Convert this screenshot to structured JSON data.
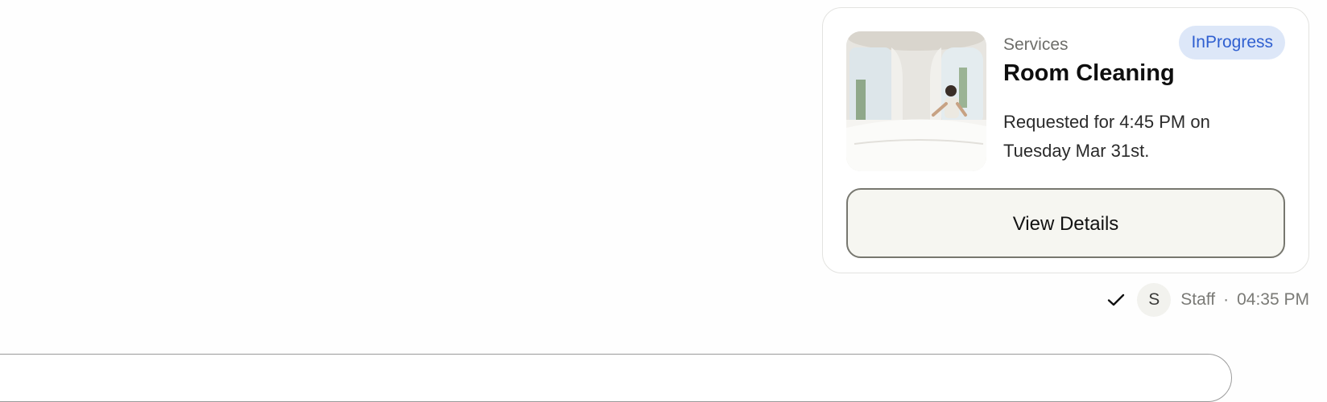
{
  "request_card": {
    "category": "Services",
    "status": "InProgress",
    "title": "Room Cleaning",
    "description": "Requested for 4:45 PM on Tuesday Mar 31st.",
    "view_details_label": "View Details",
    "image_icon": "room-photo"
  },
  "message_meta": {
    "read_icon": "check-icon",
    "avatar_initial": "S",
    "sender": "Staff",
    "separator": "·",
    "time": "04:35 PM"
  },
  "colors": {
    "status_bg": "#dde7f8",
    "status_text": "#2f5fd0",
    "button_bg": "#f6f6f1",
    "button_border": "#77776f"
  }
}
